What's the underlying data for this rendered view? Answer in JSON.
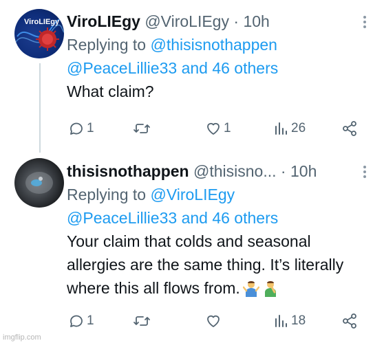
{
  "tweets": [
    {
      "author": {
        "display_name": "ViroLIEgy",
        "handle": "@ViroLIEgy",
        "time": "10h",
        "avatar_text": "ViroLIEgy"
      },
      "replying": {
        "label": "Replying to",
        "line1_mention": "@thisisnothappen",
        "line2_mention": "@PeaceLillie33",
        "line2_rest": "and 46 others"
      },
      "text": "What claim?",
      "stats": {
        "replies": "1",
        "retweets": "",
        "likes": "1",
        "views": "26"
      }
    },
    {
      "author": {
        "display_name": "thisisnothappen",
        "handle": "@thisisno...",
        "time": "10h"
      },
      "replying": {
        "label": "Replying to",
        "line1_mention": "@ViroLIEgy",
        "line2_mention": "@PeaceLillie33",
        "line2_rest": "and 46 others"
      },
      "text": "Your claim that colds and seasonal allergies are the same thing. It’s literally where this all flows from.",
      "emojis": [
        "person-shrugging-icon",
        "person-facepalming-icon"
      ],
      "stats": {
        "replies": "1",
        "retweets": "",
        "likes": "",
        "views": "18"
      }
    }
  ],
  "separator": "·",
  "watermark": "imgflip.com",
  "colors": {
    "link": "#1d9bf0",
    "muted": "#536471",
    "text": "#0f1419",
    "thread_line": "#cfd9de"
  }
}
